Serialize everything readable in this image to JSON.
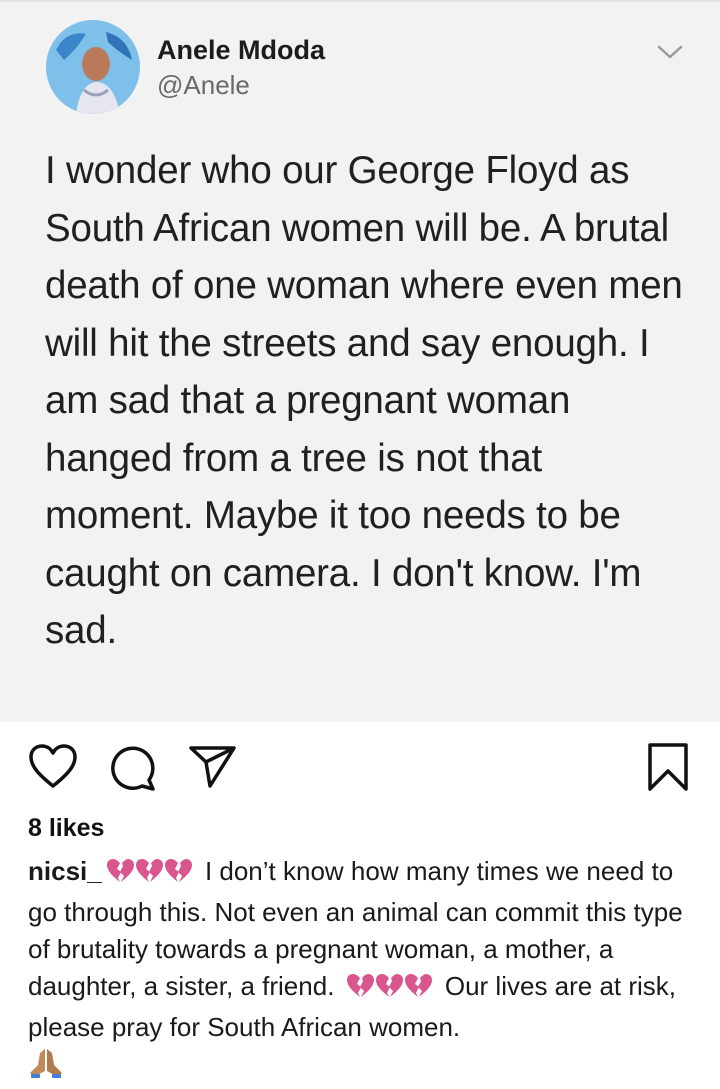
{
  "tweet": {
    "author_name": "Anele Mdoda",
    "author_handle": "@Anele",
    "text": "I wonder who our George Floyd as South African women will be. A brutal death of one woman where even men will hit the streets and say enough. I am sad that a pregnant woman hanged from a tree is not that moment. Maybe it too needs to be caught on camera. I don't know. I'm sad."
  },
  "post": {
    "likes": "8 likes",
    "caption_user": "nicsi_",
    "caption_part1": " I don’t know how many times we need to go through this. Not even an animal can commit this type of brutality towards a pregnant woman, a mother, a daughter, a sister, a friend. ",
    "caption_part2": " Our lives are at risk, please pray for South African women.",
    "icons": [
      "heart-outline-icon",
      "comment-icon",
      "share-icon",
      "bookmark-icon",
      "broken-heart-icon",
      "praying-hands-icon"
    ],
    "colors": {
      "broken_heart": "#d9568f",
      "praying_hands": "#c08a5b"
    }
  }
}
